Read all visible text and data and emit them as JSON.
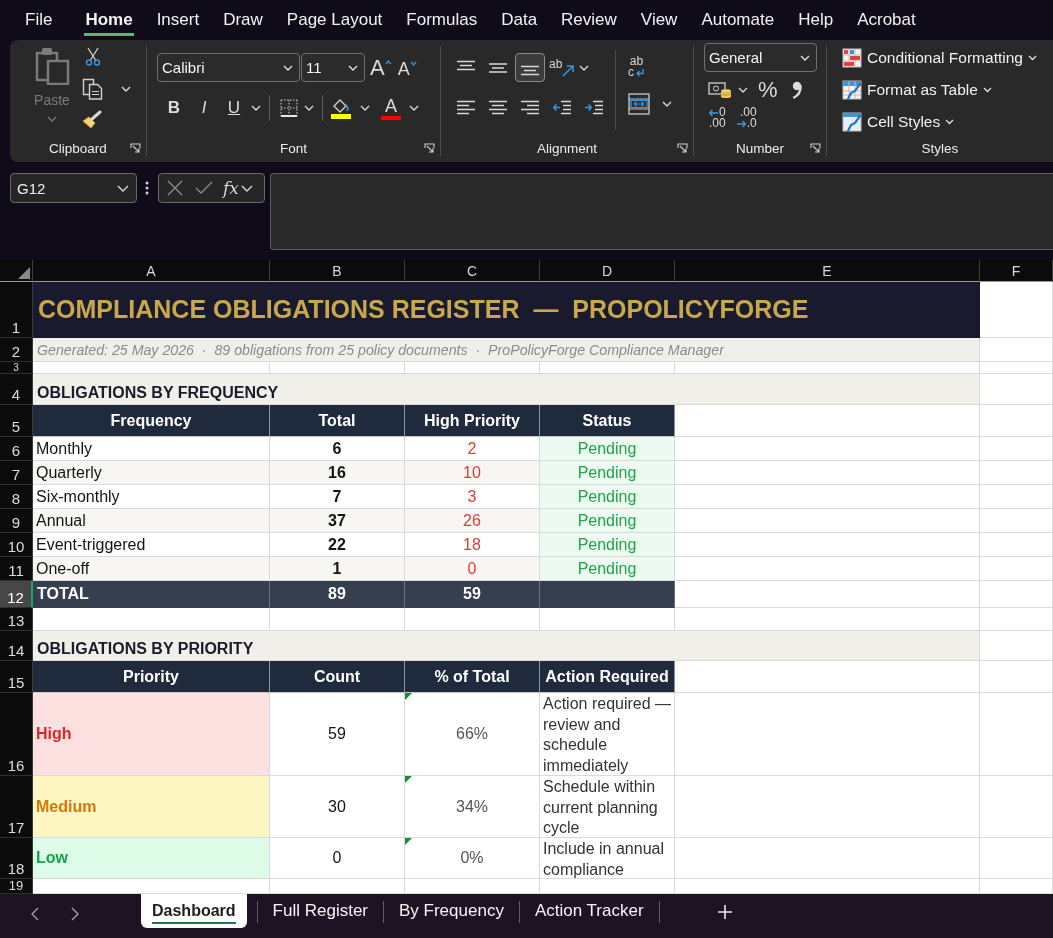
{
  "menu_tabs": [
    {
      "label": "File",
      "selected": false
    },
    {
      "label": "Home",
      "selected": true
    },
    {
      "label": "Insert",
      "selected": false
    },
    {
      "label": "Draw",
      "selected": false
    },
    {
      "label": "Page Layout",
      "selected": false
    },
    {
      "label": "Formulas",
      "selected": false
    },
    {
      "label": "Data",
      "selected": false
    },
    {
      "label": "Review",
      "selected": false
    },
    {
      "label": "View",
      "selected": false
    },
    {
      "label": "Automate",
      "selected": false
    },
    {
      "label": "Help",
      "selected": false
    },
    {
      "label": "Acrobat",
      "selected": false
    }
  ],
  "ribbon": {
    "clipboard": {
      "paste": {
        "label": "Paste",
        "disabled": true
      },
      "label": "Clipboard"
    },
    "font": {
      "name": "Calibri",
      "size": "11",
      "grow": "A",
      "shrink": "A",
      "bold": "B",
      "italic": "I",
      "underline": "U",
      "font_color": "A",
      "label": "Font"
    },
    "alignment": {
      "vertical": [
        {
          "kind": "top",
          "selected": false
        },
        {
          "kind": "middle",
          "selected": false
        },
        {
          "kind": "bottom",
          "selected": true
        }
      ],
      "orientation": "ab",
      "wrap_text": [
        "ab",
        "c"
      ],
      "label": "Alignment"
    },
    "number": {
      "format": "General",
      "percent": "%",
      "increase_decimal": [
        "0",
        ".00"
      ],
      "decrease_decimal": [
        ".00",
        ".0"
      ],
      "label": "Number"
    },
    "styles": {
      "items": [
        {
          "kind": "conditional",
          "label": "Conditional Formatting"
        },
        {
          "kind": "table",
          "label": "Format as Table"
        },
        {
          "kind": "cell",
          "label": "Cell Styles"
        }
      ],
      "label": "Styles"
    }
  },
  "formula_bar": {
    "name_box": "G12",
    "function_label": "fx"
  },
  "columns": [
    "A",
    "B",
    "C",
    "D",
    "E",
    "F"
  ],
  "row_headers": [
    {
      "label": "1",
      "selected": false
    },
    {
      "label": "2",
      "selected": false
    },
    {
      "label": "3",
      "selected": false
    },
    {
      "label": "4",
      "selected": false
    },
    {
      "label": "5",
      "selected": false
    },
    {
      "label": "6",
      "selected": false
    },
    {
      "label": "7",
      "selected": false
    },
    {
      "label": "8",
      "selected": false
    },
    {
      "label": "9",
      "selected": false
    },
    {
      "label": "10",
      "selected": false
    },
    {
      "label": "11",
      "selected": false
    },
    {
      "label": "12",
      "selected": true
    },
    {
      "label": "13",
      "selected": false
    },
    {
      "label": "14",
      "selected": false
    },
    {
      "label": "15",
      "selected": false
    },
    {
      "label": "16",
      "selected": false
    },
    {
      "label": "17",
      "selected": false
    },
    {
      "label": "18",
      "selected": false
    },
    {
      "label": "19",
      "selected": false
    }
  ],
  "sheet": {
    "title": "COMPLIANCE OBLIGATIONS REGISTER  —  PROPOLICYFORGE",
    "subtitle": "Generated: 25 May 2026  ·  89 obligations from 25 policy documents  ·  ProPolicyForge Compliance Manager",
    "frequency": {
      "heading": "OBLIGATIONS BY FREQUENCY",
      "columns": [
        "Frequency",
        "Total",
        "High Priority",
        "Status"
      ],
      "rows": [
        {
          "frequency": "Monthly",
          "total": "6",
          "high_priority": "2",
          "status": "Pending"
        },
        {
          "frequency": "Quarterly",
          "total": "16",
          "high_priority": "10",
          "status": "Pending"
        },
        {
          "frequency": "Six-monthly",
          "total": "7",
          "high_priority": "3",
          "status": "Pending"
        },
        {
          "frequency": "Annual",
          "total": "37",
          "high_priority": "26",
          "status": "Pending"
        },
        {
          "frequency": "Event-triggered",
          "total": "22",
          "high_priority": "18",
          "status": "Pending"
        },
        {
          "frequency": "One-off",
          "total": "1",
          "high_priority": "0",
          "status": "Pending"
        }
      ],
      "total": {
        "label": "TOTAL",
        "total": "89",
        "high_priority": "59"
      }
    },
    "priority": {
      "heading": "OBLIGATIONS BY PRIORITY",
      "columns": [
        "Priority",
        "Count",
        "% of Total",
        "Action Required"
      ],
      "rows": [
        {
          "kind": "high",
          "priority": "High",
          "color": "#dc2626",
          "count": "59",
          "percent": "66%",
          "flagged": true,
          "action": "Action required — review and schedule immediately"
        },
        {
          "kind": "medium",
          "priority": "Medium",
          "color": "#d97706",
          "count": "30",
          "percent": "34%",
          "flagged": true,
          "action": "Schedule within current planning cycle"
        },
        {
          "kind": "low",
          "priority": "Low",
          "color": "#16a34a",
          "count": "0",
          "percent": "0%",
          "flagged": true,
          "action": "Include in annual compliance"
        }
      ]
    }
  },
  "sheet_tabs": [
    {
      "label": "Dashboard",
      "selected": true
    },
    {
      "label": "Full Register",
      "selected": false
    },
    {
      "label": "By Frequency",
      "selected": false
    },
    {
      "label": "Action Tracker",
      "selected": false
    }
  ]
}
